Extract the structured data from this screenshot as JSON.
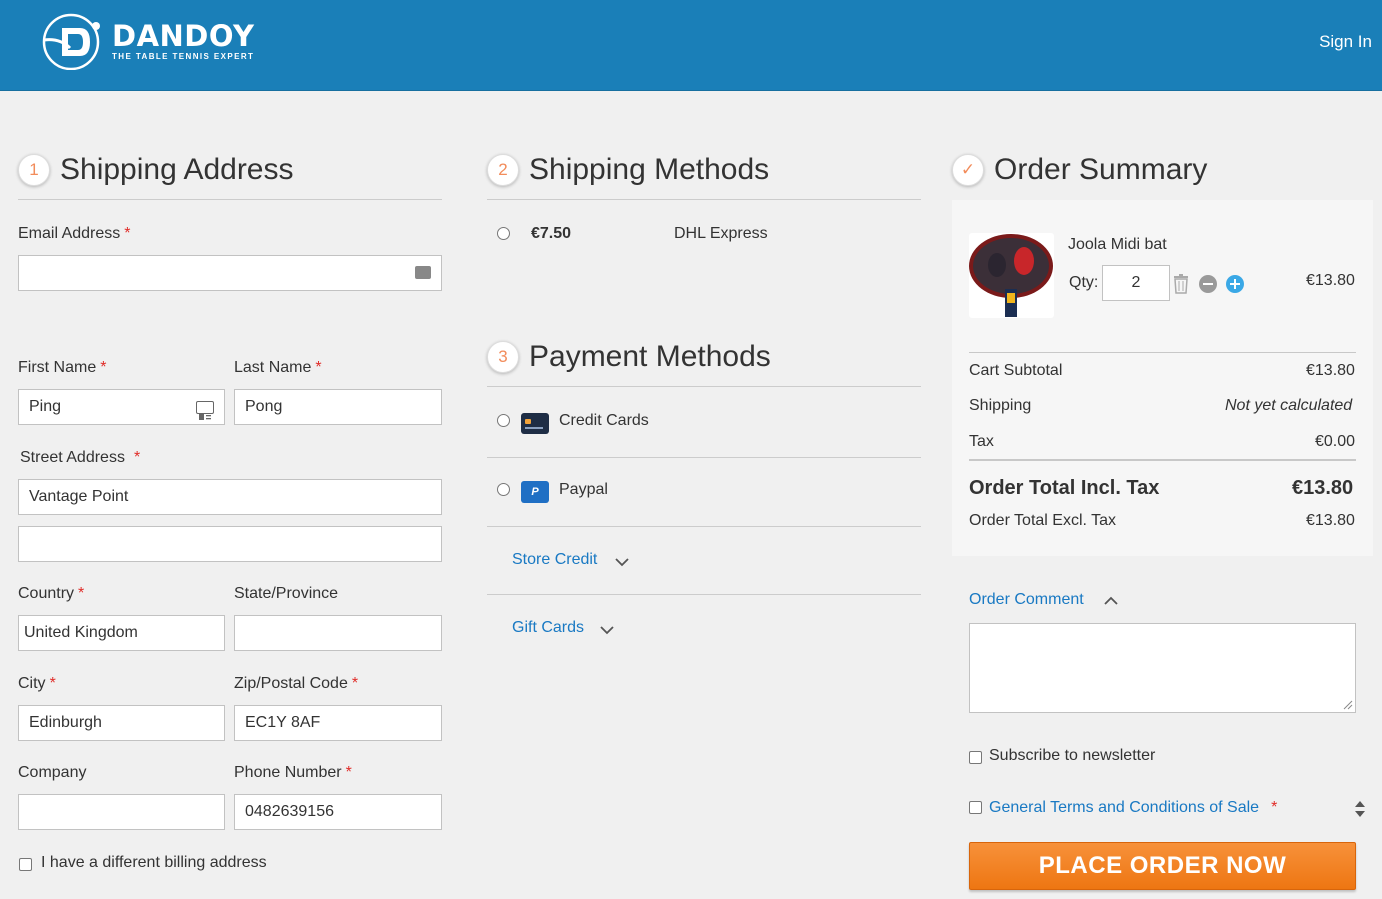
{
  "header": {
    "brand_name": "DANDOY",
    "brand_tagline": "THE TABLE TENNIS EXPERT",
    "sign_in": "Sign In",
    "bg_color": "#1a7fb8"
  },
  "shipping_address": {
    "step": "1",
    "title": "Shipping Address",
    "email_label": "Email Address",
    "email_value": "",
    "first_name_label": "First Name",
    "first_name_value": "Ping",
    "last_name_label": "Last Name",
    "last_name_value": "Pong",
    "street_label": "Street Address",
    "street_line1": "Vantage Point",
    "street_line2": "",
    "country_label": "Country",
    "country_value": "United Kingdom",
    "state_label": "State/Province",
    "state_value": "",
    "city_label": "City",
    "city_value": "Edinburgh",
    "zip_label": "Zip/Postal Code",
    "zip_value": "EC1Y 8AF",
    "company_label": "Company",
    "company_value": "",
    "phone_label": "Phone Number",
    "phone_value": "0482639156",
    "billing_checkbox_label": "I have a different billing address",
    "required_mark": "*"
  },
  "shipping_methods": {
    "step": "2",
    "title": "Shipping Methods",
    "options": [
      {
        "price": "€7.50",
        "carrier": "DHL Express"
      }
    ]
  },
  "payment_methods": {
    "step": "3",
    "title": "Payment Methods",
    "options": [
      {
        "label": "Credit Cards",
        "icon": "credit-card-icon"
      },
      {
        "label": "Paypal",
        "icon": "paypal-icon"
      }
    ],
    "store_credit": "Store Credit",
    "gift_cards": "Gift Cards"
  },
  "order_summary": {
    "step_icon": "✓",
    "title": "Order Summary",
    "item": {
      "name": "Joola Midi bat",
      "qty_label": "Qty:",
      "qty": "2",
      "price": "€13.80"
    },
    "totals": [
      {
        "label": "Cart Subtotal",
        "value": "€13.80"
      },
      {
        "label": "Shipping",
        "value": "Not yet calculated"
      },
      {
        "label": "Tax",
        "value": "€0.00"
      }
    ],
    "grand_total_label": "Order Total Incl. Tax",
    "grand_total_value": "€13.80",
    "excl_total_label": "Order Total Excl. Tax",
    "excl_total_value": "€13.80",
    "order_comment_label": "Order Comment",
    "comment_value": "",
    "newsletter_label": "Subscribe to newsletter",
    "terms_label": "General Terms and Conditions of Sale",
    "place_order": "PLACE ORDER NOW",
    "accent_color": "#f28c1e"
  }
}
